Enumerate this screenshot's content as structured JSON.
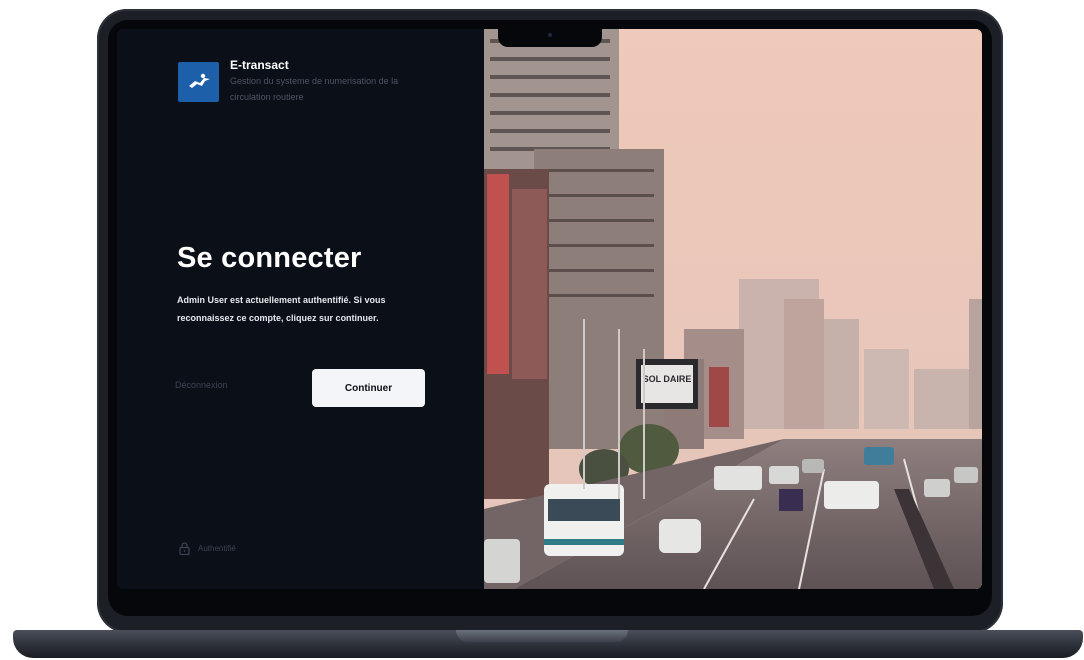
{
  "brand": {
    "title": "E-transact",
    "subtitle": "Gestion du systeme de numerisation de la circulation routiere",
    "logo_icon": "running-figure-icon",
    "accent": "#1d5fa8"
  },
  "login": {
    "heading": "Se connecter",
    "message": "Admin User est actuellement authentifié. Si vous reconnaissez ce compte, cliquez sur continuer.",
    "logout_label": "Déconnexion",
    "continue_label": "Continuer"
  },
  "footer": {
    "status_icon": "lock-icon",
    "status_label": "Authentifié"
  },
  "photo": {
    "sign_text": "SOL DAIRE"
  },
  "colors": {
    "panel_bg": "#0b0f17",
    "button_bg": "#f4f5f8",
    "muted_text": "#3c4452"
  }
}
